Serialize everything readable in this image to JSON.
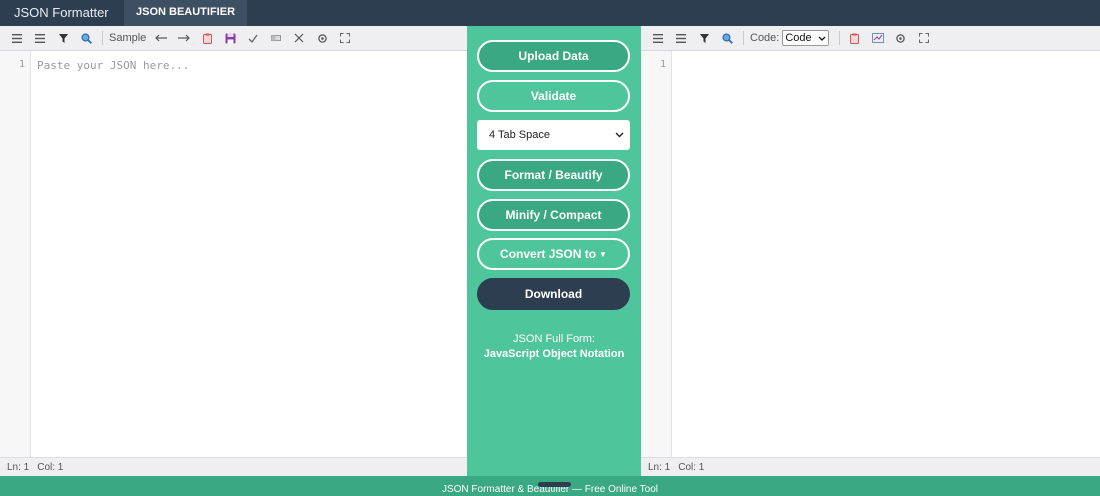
{
  "nav": {
    "brand": "JSON Formatter",
    "active_tab": "JSON BEAUTIFIER"
  },
  "left_panel": {
    "toolbar": {
      "sample_label": "Sample"
    },
    "gutter_line": "1",
    "placeholder": "Paste your JSON here...",
    "status": {
      "ln": "Ln: 1",
      "col": "Col: 1"
    }
  },
  "middle": {
    "upload_label": "Upload Data",
    "validate_label": "Validate",
    "indent_select": {
      "selected": "4 Tab Space"
    },
    "format_label": "Format / Beautify",
    "minify_label": "Minify / Compact",
    "convert_label": "Convert JSON to",
    "download_label": "Download",
    "fullform_title": "JSON Full Form:",
    "fullform_value": "JavaScript Object Notation"
  },
  "right_panel": {
    "toolbar": {
      "code_label": "Code:",
      "code_select": "Code"
    },
    "gutter_line": "1",
    "status": {
      "ln": "Ln: 1",
      "col": "Col: 1"
    }
  },
  "footer": {
    "text": "JSON Formatter & Beautifier — Free Online Tool"
  },
  "colors": {
    "nav_bg": "#2c3e50",
    "accent_green": "#4fc59c",
    "button_green": "#3aa882",
    "download_bg": "#2c3e50"
  }
}
